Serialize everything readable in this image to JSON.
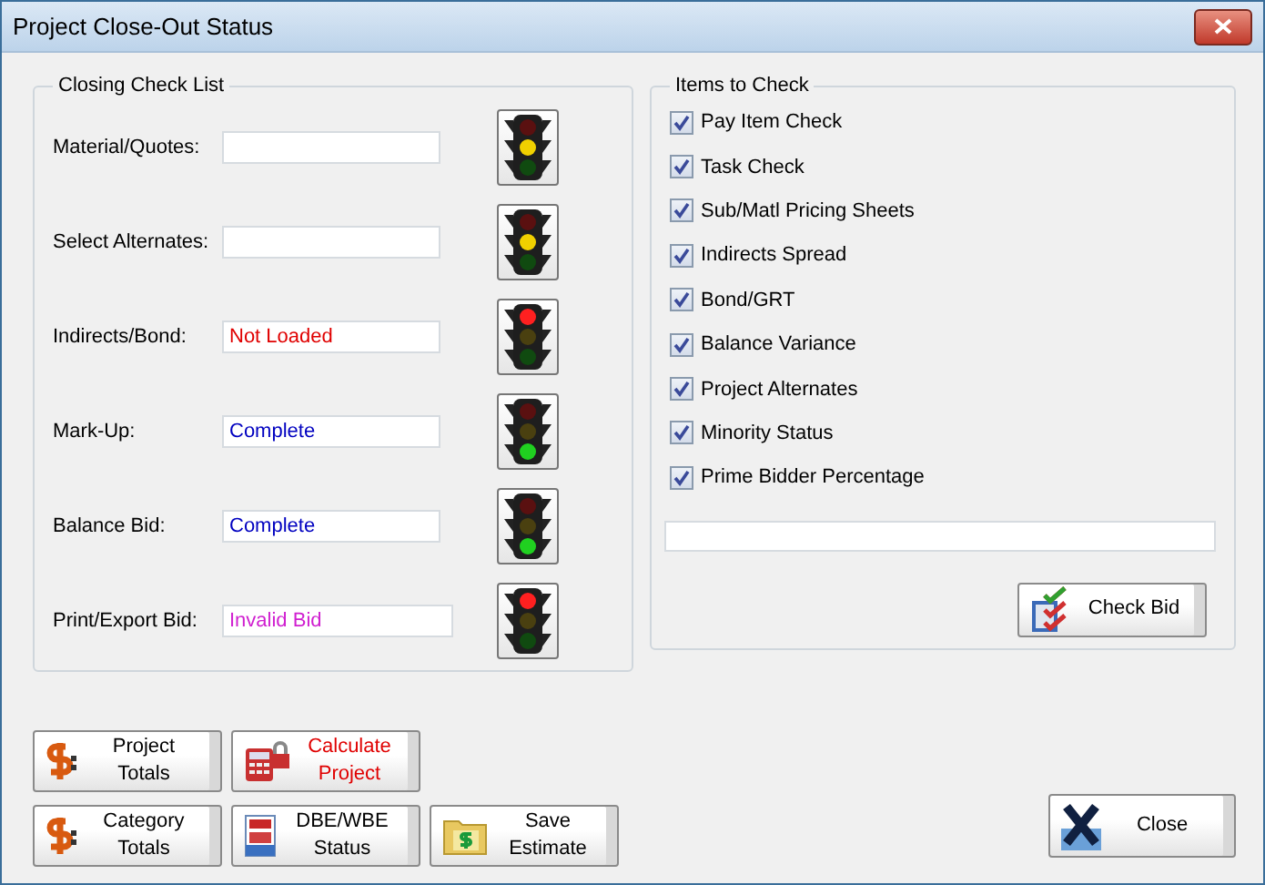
{
  "window": {
    "title": "Project Close-Out Status"
  },
  "closing_check_list": {
    "title": "Closing Check List",
    "rows": [
      {
        "label": "Material/Quotes:",
        "signal": {
          "color": "#f0d000"
        }
      },
      {
        "label": "Select Alternates:",
        "signal": {
          "color": "#f0d000"
        }
      },
      {
        "label": "Indirects/Bond:",
        "value": "Not Loaded",
        "color": "#e00000",
        "signal": {
          "color": "#ff2020"
        }
      },
      {
        "label": "Mark-Up:",
        "value": "Complete",
        "color": "#0000c0",
        "signal": {
          "color": "#20d020"
        }
      },
      {
        "label": "Balance Bid:",
        "value": "Complete",
        "color": "#0000c0",
        "signal": {
          "color": "#20d020"
        }
      },
      {
        "label": "Print/Export Bid:",
        "value": "Invalid Bid",
        "color": "#d020d0",
        "signal": {
          "color": "#ff2020"
        }
      }
    ]
  },
  "items_to_check": {
    "title": "Items to Check",
    "items": [
      {
        "label": "Pay Item Check",
        "checked": true
      },
      {
        "label": "Task Check",
        "checked": true
      },
      {
        "label": "Sub/Matl Pricing Sheets",
        "checked": true
      },
      {
        "label": "Indirects Spread",
        "checked": true
      },
      {
        "label": "Bond/GRT",
        "checked": true
      },
      {
        "label": "Balance Variance",
        "checked": true
      },
      {
        "label": "Project Alternates",
        "checked": true
      },
      {
        "label": "Minority Status",
        "checked": true
      },
      {
        "label": "Prime Bidder Percentage",
        "checked": true
      }
    ],
    "check_button": "Check Bid"
  },
  "button_rows": [
    {
      "buttons": [
        {
          "label": "Project Totals",
          "kind": "dollar",
          "alert": false
        },
        {
          "label": "Calculate Project",
          "kind": "calculator",
          "alert": true
        }
      ]
    },
    {
      "buttons": [
        {
          "label": "Category Totals",
          "kind": "dollar",
          "alert": false
        },
        {
          "label": "DBE/WBE Status",
          "kind": "report",
          "alert": false
        },
        {
          "label": "Save Estimate",
          "kind": "folder",
          "alert": false
        }
      ]
    }
  ],
  "close_button": {
    "label": "Close",
    "kind": "close"
  }
}
